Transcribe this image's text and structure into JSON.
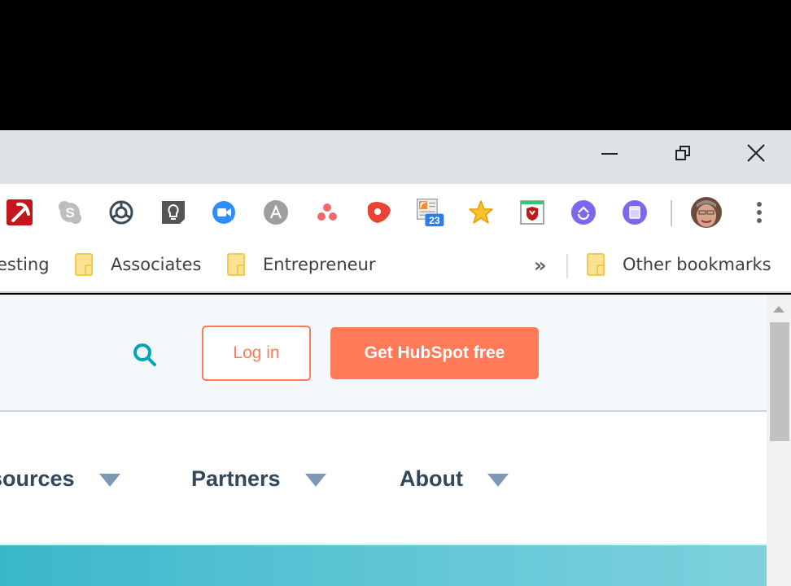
{
  "window": {
    "controls": {
      "minimize": "minimize",
      "restore": "restore",
      "close": "close"
    }
  },
  "toolbar": {
    "extensions": [
      {
        "name": "pickaxe-extension",
        "icon": "pickaxe-icon",
        "color": "#c4161c"
      },
      {
        "name": "skype-extension",
        "icon": "skype-icon",
        "color": "#b8b8b8"
      },
      {
        "name": "openai-extension",
        "icon": "openai-knot-icon",
        "color": "#3c4a55"
      },
      {
        "name": "idea-extension",
        "icon": "lightbulb-icon",
        "color": "#555555"
      },
      {
        "name": "zoom-extension",
        "icon": "video-camera-icon",
        "color": "#2d8cff"
      },
      {
        "name": "grey-a-extension",
        "icon": "letter-a-icon",
        "color": "#9e9e9e"
      },
      {
        "name": "asana-extension",
        "icon": "asana-dots-icon",
        "color": "#f06a6a"
      },
      {
        "name": "red-shape-extension",
        "icon": "red-record-icon",
        "color": "#ea4335"
      },
      {
        "name": "rss-extension",
        "icon": "rss-feed-icon",
        "badge": "23",
        "badge_color": "#2b7de9"
      },
      {
        "name": "bookmark-star-extension",
        "icon": "star-icon",
        "color": "#fbc02d"
      },
      {
        "name": "mcafee-extension",
        "icon": "mcafee-shield-icon",
        "color": "#c01818"
      },
      {
        "name": "purple-arc-extension",
        "icon": "purple-chevron-icon",
        "color": "#7b68ee"
      },
      {
        "name": "purple-window-extension",
        "icon": "purple-window-icon",
        "color": "#7b68ee"
      }
    ],
    "profile": "profile-avatar",
    "menu": "kebab-menu"
  },
  "bookmarks": {
    "items": [
      {
        "label": "esting",
        "icon": "folder-icon"
      },
      {
        "label": "Associates",
        "icon": "folder-icon"
      },
      {
        "label": "Entrepreneur",
        "icon": "folder-icon"
      }
    ],
    "overflow": "»",
    "other": "Other bookmarks"
  },
  "page": {
    "utility": {
      "login_label": "Log in",
      "cta_label": "Get HubSpot free"
    },
    "nav": [
      {
        "label": "sources"
      },
      {
        "label": "Partners"
      },
      {
        "label": "About"
      }
    ]
  },
  "colors": {
    "accent": "#ff7a59",
    "nav_text": "#33475b",
    "nav_caret": "#7c98b6",
    "search": "#00a4bd",
    "hero_start": "#3ab7ca",
    "hero_end": "#7ed1dd"
  }
}
